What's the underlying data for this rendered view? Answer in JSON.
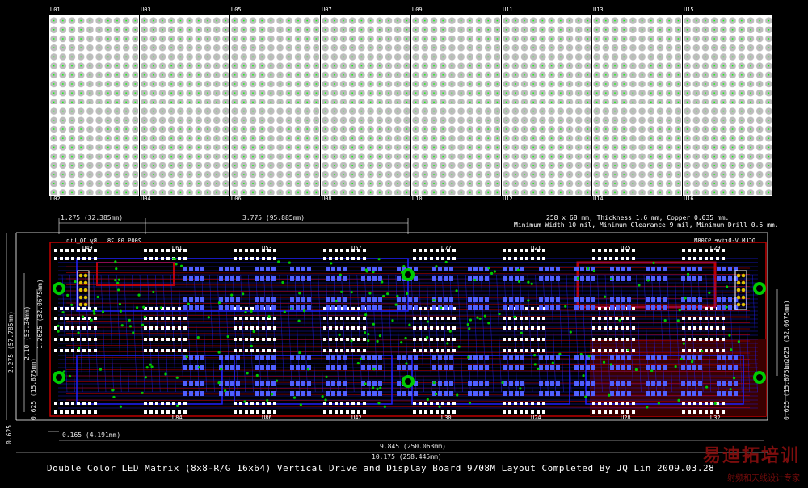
{
  "colors": {
    "background": "#000000",
    "matrix_body": "#ffffff",
    "led_dot": "#bdbdbd",
    "led_center": "#00ff00",
    "copper_top": "#c00000",
    "copper_bottom": "#2020ff",
    "silkscreen": "#ffffff",
    "via": "#00cc00",
    "watermark": "#8a0f0f"
  },
  "matrices": {
    "top_row": [
      "U01",
      "U03",
      "U05",
      "U07",
      "U09",
      "U11",
      "U13",
      "U15"
    ],
    "bottom_row": [
      "U02",
      "U04",
      "U06",
      "U08",
      "U10",
      "U12",
      "U14",
      "U16"
    ]
  },
  "pcb": {
    "dims": {
      "d1": "1.275 (32.385mm)",
      "d2": "3.775 (95.885mm)",
      "d3": "0.165 (4.191mm)",
      "d4": "9.845 (250.063mm)",
      "d5": "10.175 (258.445mm)",
      "left1": "2.275 (57.785mm)",
      "left2": "2.10 (53.34mm)",
      "left3": "1.2625 (32.0675mm)",
      "left4": "0.625 (15.875mm)",
      "left5": "0.625",
      "right1": "1.2625 (32.0675mm)",
      "right2": "0.625 (15.875mm)"
    },
    "specs_line1": "258 x 68 mm, Thickness 1.6 mm, Copper 0.035 mm.",
    "specs_line2": "Minimum Width 10 mil, Minimum Clearance 9 mil, Minimum Drill 0.6 mm.",
    "board_label_mirrored": "DCLM V-Drive 9708M",
    "date_mirrored": "2009.03.28",
    "author_mirrored": "By JQ_Lin",
    "chip_labels_top": [
      "U49",
      "U61",
      "U53",
      "U57",
      "U77",
      "U21",
      "U25",
      "U29"
    ],
    "chip_labels_bottom": [
      "U84",
      "U86",
      "U42",
      "U30",
      "U24",
      "U28",
      "U32"
    ]
  },
  "footer": {
    "title": "Double Color LED Matrix (8x8-R/G 16x64) Vertical Drive and Display Board 9708M   Layout Completed By JQ_Lin   2009.03.28"
  },
  "watermark": {
    "big": "易迪拓培训",
    "small": "射频和天线设计专家"
  }
}
